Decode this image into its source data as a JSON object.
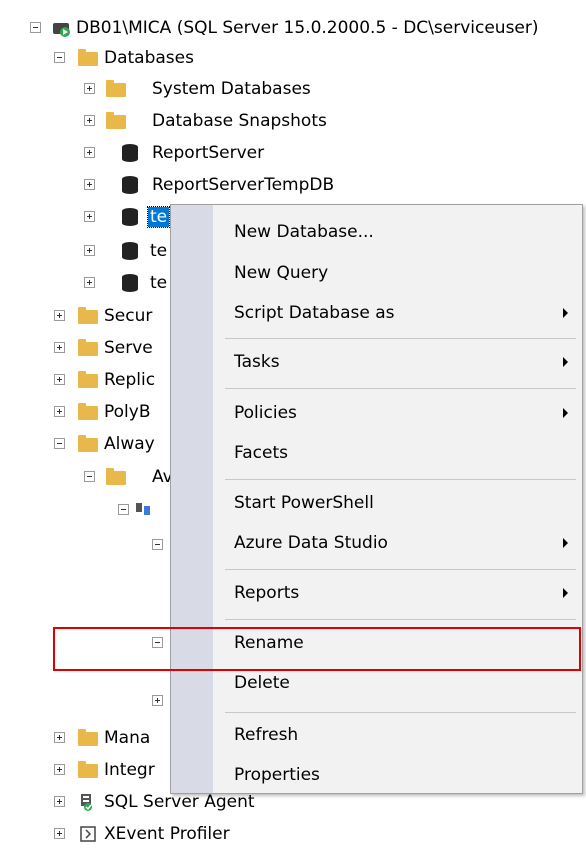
{
  "tree": {
    "server": "DB01\\MICA (SQL Server 15.0.2000.5 - DC\\serviceuser)",
    "databases": "Databases",
    "system_databases": "System Databases",
    "database_snapshots": "Database Snapshots",
    "report_server": "ReportServer",
    "report_server_temp": "ReportServerTempDB",
    "db_te1": "te",
    "db_te2": "te",
    "db_te3": "te",
    "security": "Secur",
    "server_objects": "Serve",
    "replication": "Replic",
    "polybase": "PolyB",
    "always_on": "Alway",
    "availability": "Av",
    "management": "Mana",
    "integration": "Integr",
    "sql_agent": "SQL Server Agent",
    "xevent": "XEvent Profiler"
  },
  "menu": {
    "new_database": "New Database...",
    "new_query": "New Query",
    "script_database_as": "Script Database as",
    "tasks": "Tasks",
    "policies": "Policies",
    "facets": "Facets",
    "start_powershell": "Start PowerShell",
    "azure_data_studio": "Azure Data Studio",
    "reports": "Reports",
    "rename": "Rename",
    "delete": "Delete",
    "refresh": "Refresh",
    "properties": "Properties"
  },
  "colors": {
    "selection": "#0078d7",
    "highlight_box": "#e00000",
    "folder": "#e8b94a",
    "menu_gutter": "#d8dbe6"
  }
}
